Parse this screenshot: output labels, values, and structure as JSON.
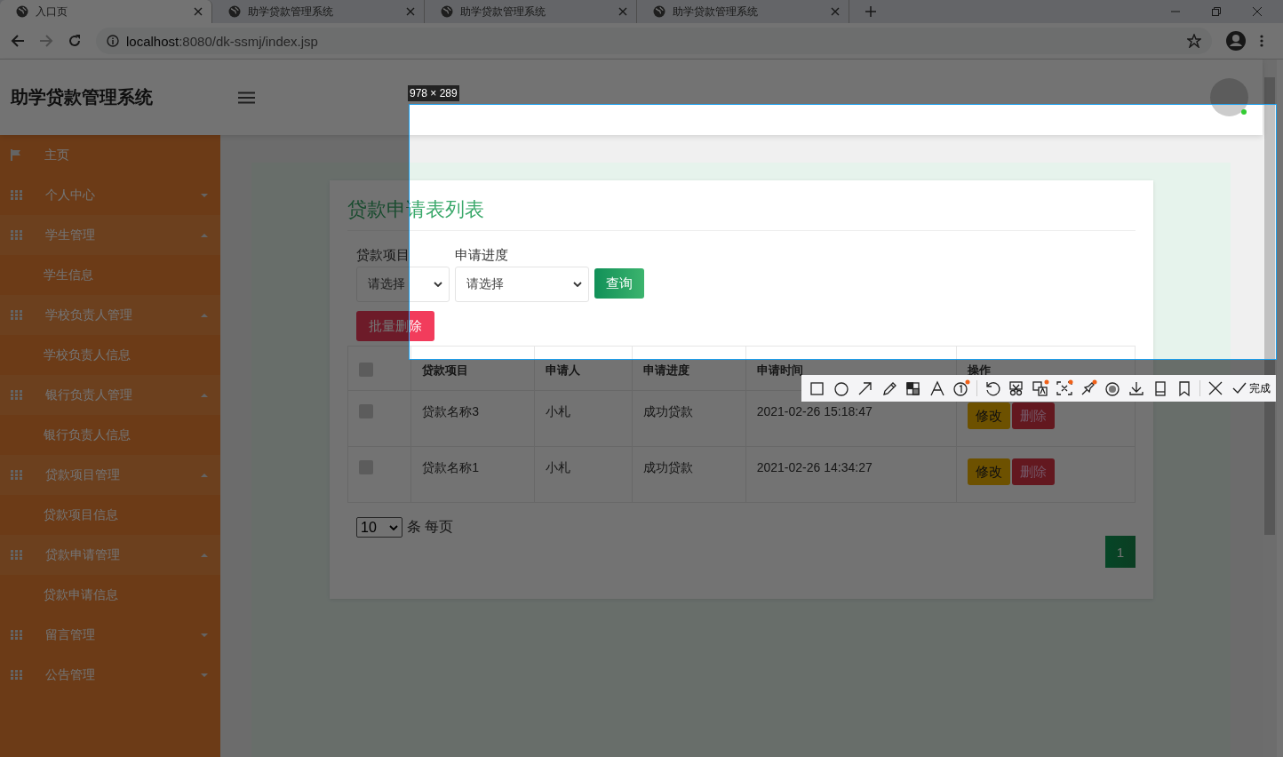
{
  "browser": {
    "tabs": [
      {
        "title": "入口页",
        "selected": true
      },
      {
        "title": "助学贷款管理系统",
        "selected": false
      },
      {
        "title": "助学贷款管理系统",
        "selected": false
      },
      {
        "title": "助学贷款管理系统",
        "selected": false
      }
    ],
    "url_host": "localhost",
    "url_rest": ":8080/dk-ssmj/index.jsp"
  },
  "header": {
    "title": "助学贷款管理系统"
  },
  "sidebar": {
    "items": [
      {
        "kind": "link",
        "label": "主页"
      },
      {
        "kind": "group",
        "label": "个人中心",
        "expanded": false
      },
      {
        "kind": "group",
        "label": "学生管理",
        "expanded": true,
        "children": [
          {
            "label": "学生信息"
          }
        ]
      },
      {
        "kind": "group",
        "label": "学校负责人管理",
        "expanded": true,
        "children": [
          {
            "label": "学校负责人信息"
          }
        ]
      },
      {
        "kind": "group",
        "label": "银行负责人管理",
        "expanded": true,
        "children": [
          {
            "label": "银行负责人信息"
          }
        ]
      },
      {
        "kind": "group",
        "label": "贷款项目管理",
        "expanded": true,
        "children": [
          {
            "label": "贷款项目信息"
          }
        ]
      },
      {
        "kind": "group",
        "label": "贷款申请管理",
        "expanded": true,
        "children": [
          {
            "label": "贷款申请信息"
          }
        ]
      },
      {
        "kind": "group",
        "label": "留言管理",
        "expanded": false
      },
      {
        "kind": "group",
        "label": "公告管理",
        "expanded": false
      }
    ]
  },
  "content": {
    "title": "贷款申请表列表",
    "filters": [
      {
        "label": "贷款项目",
        "value": "请选择"
      },
      {
        "label": "申请进度",
        "value": "请选择"
      }
    ],
    "search_button": "查询",
    "batch_delete_button": "批量删除",
    "table": {
      "select_all_checked": false,
      "columns": [
        "贷款项目",
        "申请人",
        "申请进度",
        "申请时间",
        "操作"
      ],
      "rows": [
        {
          "checked": false,
          "cells": [
            "贷款名称3",
            "小札",
            "成功贷款",
            "2021-02-26 15:18:47"
          ],
          "actions": [
            "修改",
            "删除"
          ]
        },
        {
          "checked": false,
          "cells": [
            "贷款名称1",
            "小札",
            "成功贷款",
            "2021-02-26 14:34:27"
          ],
          "actions": [
            "修改",
            "删除"
          ]
        }
      ]
    },
    "page_size": "10",
    "page_size_label": "条 每页",
    "pages": [
      {
        "label": "1",
        "selected": true
      }
    ]
  },
  "capture": {
    "size_label": "978 × 289",
    "tools": [
      {
        "kind": "rect",
        "dot": false
      },
      {
        "kind": "circle",
        "dot": false
      },
      {
        "kind": "arrow",
        "dot": false
      },
      {
        "kind": "pencil",
        "dot": false
      },
      {
        "kind": "mosaic",
        "dot": false
      },
      {
        "kind": "text",
        "dot": false
      },
      {
        "kind": "number",
        "dot": true
      },
      {
        "kind": "undo",
        "dot": false
      },
      {
        "kind": "cut",
        "dot": false
      },
      {
        "kind": "translate",
        "dot": true
      },
      {
        "kind": "ocr",
        "dot": true
      },
      {
        "kind": "pin",
        "dot": true
      },
      {
        "kind": "record",
        "dot": false
      },
      {
        "kind": "download",
        "dot": false
      },
      {
        "kind": "phone",
        "dot": false
      },
      {
        "kind": "bookmark",
        "dot": false
      },
      {
        "kind": "close",
        "dot": false
      }
    ],
    "done_label": "完成"
  }
}
